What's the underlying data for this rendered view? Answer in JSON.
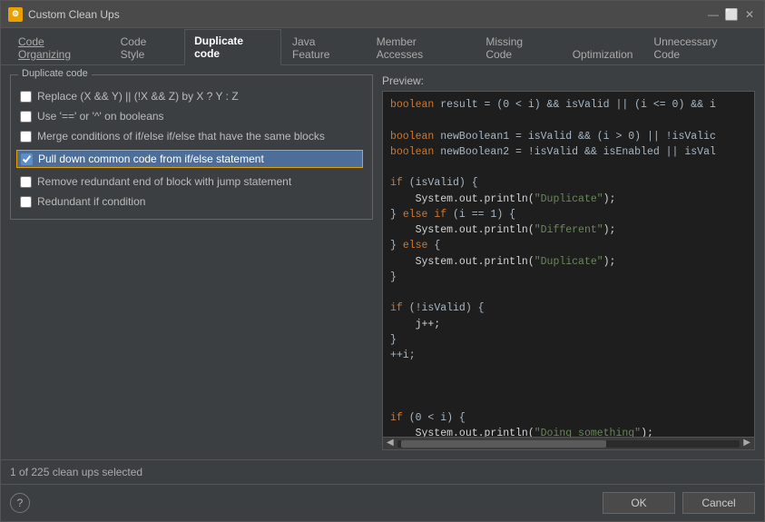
{
  "window": {
    "title": "Custom Clean Ups",
    "icon_label": "CC"
  },
  "tabs": [
    {
      "id": "code-organizing",
      "label": "Code Organizing",
      "active": false,
      "underline": true
    },
    {
      "id": "code-style",
      "label": "Code Style",
      "active": false,
      "underline": false
    },
    {
      "id": "duplicate-code",
      "label": "Duplicate code",
      "active": true,
      "underline": false
    },
    {
      "id": "java-feature",
      "label": "Java Feature",
      "active": false,
      "underline": false
    },
    {
      "id": "member-accesses",
      "label": "Member Accesses",
      "active": false,
      "underline": false
    },
    {
      "id": "missing-code",
      "label": "Missing Code",
      "active": false,
      "underline": false
    },
    {
      "id": "optimization",
      "label": "Optimization",
      "active": false,
      "underline": false
    },
    {
      "id": "unnecessary-code",
      "label": "Unnecessary Code",
      "active": false,
      "underline": false
    }
  ],
  "group_title": "Duplicate code",
  "checkboxes": [
    {
      "id": "cb1",
      "label": "Replace (X && Y) || (!X && Z) by X ? Y : Z",
      "checked": false,
      "selected": false
    },
    {
      "id": "cb2",
      "label": "Use '==' or '^' on booleans",
      "checked": false,
      "selected": false
    },
    {
      "id": "cb3",
      "label": "Merge conditions of if/else if/else that have the same blocks",
      "checked": false,
      "selected": false
    },
    {
      "id": "cb4",
      "label": "Pull down common code from if/else statement",
      "checked": true,
      "selected": true
    },
    {
      "id": "cb5",
      "label": "Remove redundant end of block with jump statement",
      "checked": false,
      "selected": false
    },
    {
      "id": "cb6",
      "label": "Redundant if condition",
      "checked": false,
      "selected": false
    }
  ],
  "preview_label": "Preview:",
  "status": "1 of 225 clean ups selected",
  "buttons": {
    "help": "?",
    "ok": "OK",
    "cancel": "Cancel"
  }
}
